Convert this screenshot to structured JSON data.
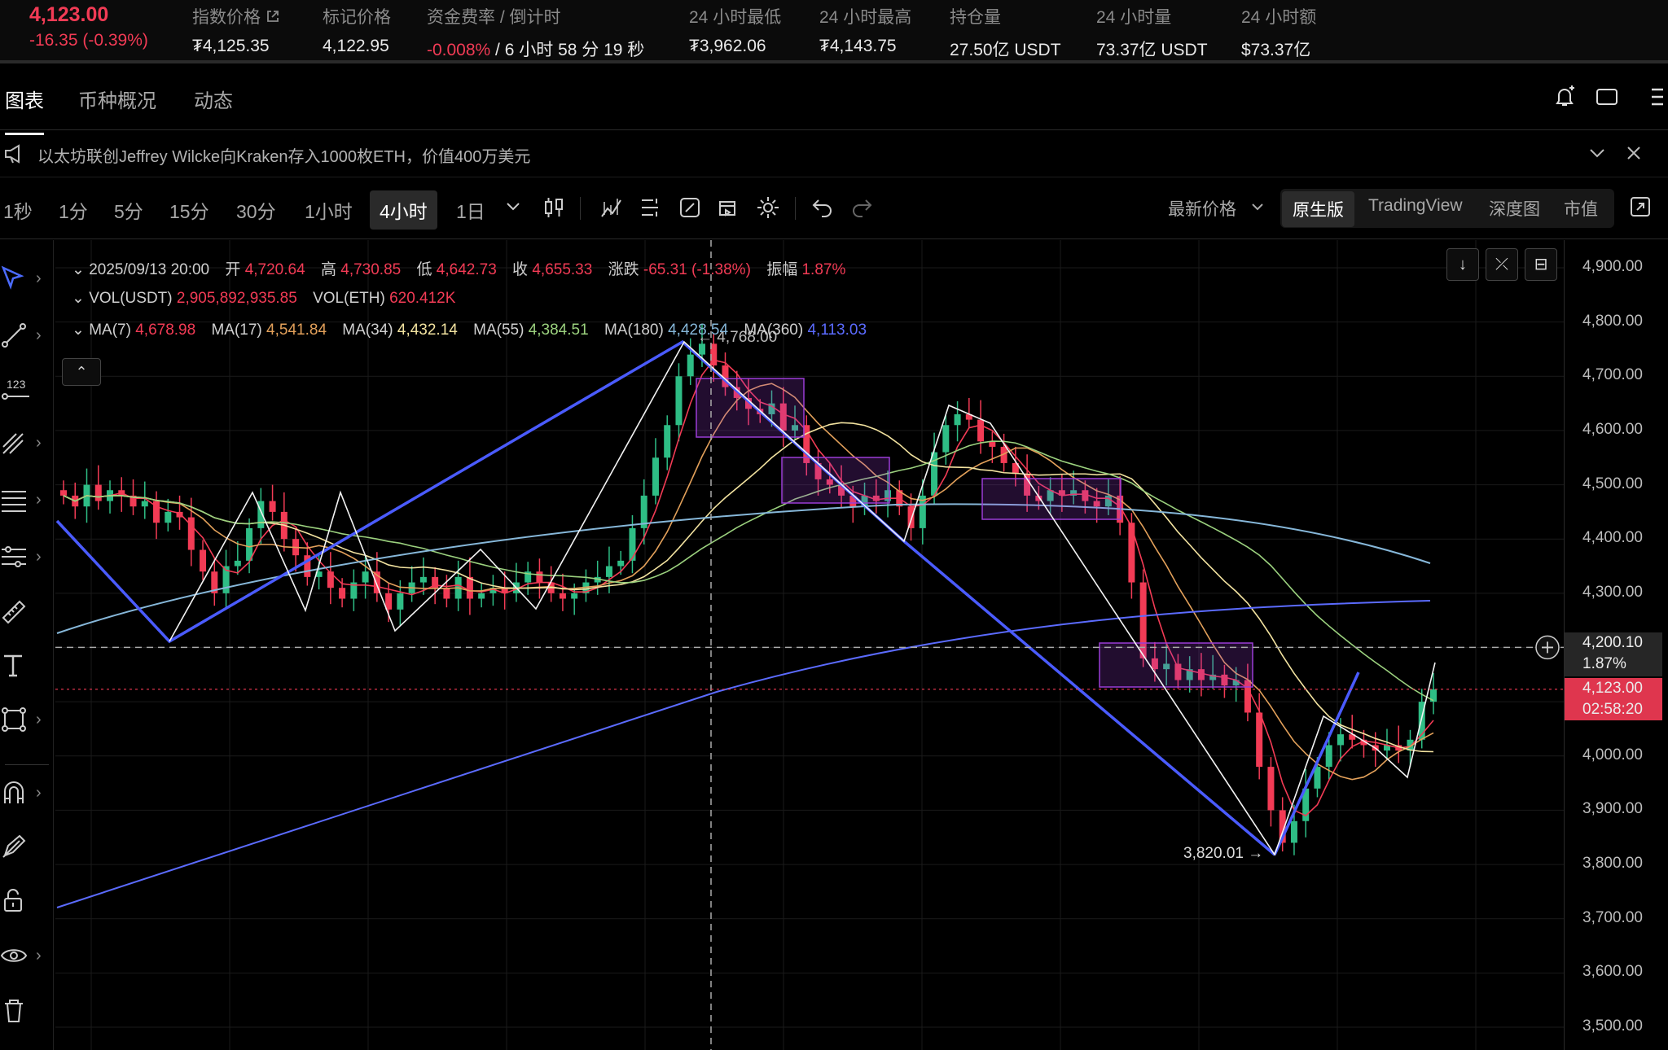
{
  "ticker": {
    "last_price": "4,123.00",
    "change": "-16.35 (-0.39%)"
  },
  "stats": [
    {
      "label": "指数价格",
      "value": "₮4,125.35",
      "has_link_icon": true
    },
    {
      "label": "标记价格",
      "value": "4,122.95"
    },
    {
      "label": "资金费率 / 倒计时",
      "value_neg": "-0.008%",
      "value": " / 6 小时 58 分 19 秒"
    },
    {
      "label": "24 小时最低",
      "value": "₮3,962.06"
    },
    {
      "label": "24 小时最高",
      "value": "₮4,143.75"
    },
    {
      "label": "持仓量",
      "value": "27.50亿 USDT"
    },
    {
      "label": "24 小时量",
      "value": "73.37亿 USDT"
    },
    {
      "label": "24 小时额",
      "value": "$73.37亿"
    }
  ],
  "tabs": [
    "图表",
    "币种概况",
    "动态"
  ],
  "news": "以太坊联创Jeffrey Wilcke向Kraken存入1000枚ETH，价值400万美元",
  "timeframes": [
    "1秒",
    "1分",
    "5分",
    "15分",
    "30分",
    "1小时",
    "4小时",
    "1日"
  ],
  "active_timeframe": "4小时",
  "price_source": "最新价格",
  "render_modes": [
    "原生版",
    "TradingView",
    "深度图",
    "市值"
  ],
  "active_render_mode": "原生版",
  "legend": {
    "date": "2025/09/13 20:00",
    "open_label": "开",
    "open": "4,720.64",
    "high_label": "高",
    "high": "4,730.85",
    "low_label": "低",
    "low": "4,642.73",
    "close_label": "收",
    "close": "4,655.33",
    "change_label": "涨跌",
    "change": "-65.31 (-1.38%)",
    "amp_label": "振幅",
    "amp": "1.87%",
    "vol_usdt_label": "VOL(USDT)",
    "vol_usdt": "2,905,892,935.85",
    "vol_eth_label": "VOL(ETH)",
    "vol_eth": "620.412K",
    "ma7_label": "MA(7)",
    "ma7": "4,678.98",
    "ma17_label": "MA(17)",
    "ma17": "4,541.84",
    "ma34_label": "MA(34)",
    "ma34": "4,432.14",
    "ma55_label": "MA(55)",
    "ma55": "4,384.51",
    "ma180_label": "MA(180)",
    "ma180": "4,428.54",
    "ma360_label": "MA(360)",
    "ma360": "4,113.03"
  },
  "annotations": {
    "peak": "4,768.00",
    "trough": "3,820.01"
  },
  "yaxis": {
    "ticks": [
      "4,900.00",
      "4,800.00",
      "4,700.00",
      "4,600.00",
      "4,500.00",
      "4,400.00",
      "4,300.00",
      "4,000.00",
      "3,900.00",
      "3,800.00",
      "3,700.00",
      "3,600.00",
      "3,500.00"
    ],
    "crosshair_price": "4,200.10",
    "crosshair_pct": "1.87%",
    "last_price": "4,123.00",
    "countdown": "02:58:20"
  },
  "chart_data": {
    "type": "line",
    "xlabel": "",
    "ylabel": "",
    "ylim": [
      3480,
      4930
    ],
    "series": [
      {
        "name": "MA(7)",
        "color": "#f23b55"
      },
      {
        "name": "MA(17)",
        "color": "#e2a05a"
      },
      {
        "name": "MA(34)",
        "color": "#f3e3a0"
      },
      {
        "name": "MA(55)",
        "color": "#9bd17e"
      },
      {
        "name": "MA(180)",
        "color": "#86b7d9"
      },
      {
        "name": "MA(360)",
        "color": "#5b6bff"
      }
    ],
    "candles_close": [
      4480,
      4460,
      4500,
      4470,
      4490,
      4480,
      4460,
      4470,
      4430,
      4450,
      4440,
      4380,
      4340,
      4300,
      4350,
      4360,
      4420,
      4470,
      4450,
      4400,
      4370,
      4330,
      4340,
      4310,
      4290,
      4320,
      4340,
      4300,
      4270,
      4300,
      4320,
      4330,
      4310,
      4290,
      4330,
      4290,
      4300,
      4310,
      4300,
      4320,
      4340,
      4320,
      4300,
      4290,
      4300,
      4320,
      4330,
      4350,
      4360,
      4420,
      4480,
      4550,
      4610,
      4700,
      4740,
      4760,
      4720,
      4680,
      4660,
      4640,
      4630,
      4650,
      4600,
      4610,
      4540,
      4510,
      4500,
      4480,
      4460,
      4480,
      4470,
      4490,
      4460,
      4420,
      4480,
      4560,
      4610,
      4630,
      4620,
      4580,
      4570,
      4540,
      4520,
      4480,
      4470,
      4490,
      4480,
      4490,
      4470,
      4460,
      4480,
      4430,
      4320,
      4180,
      4160,
      4170,
      4140,
      4160,
      4140,
      4150,
      4130,
      4140,
      4080,
      3980,
      3900,
      3840,
      3880,
      3940,
      3980,
      4020,
      4040,
      4030,
      4020,
      4010,
      4020,
      4010,
      4030,
      4100,
      4123
    ],
    "trend_lines": "blue and white zigzag annotations",
    "crosshair_value": 4200.1,
    "last_price_value": 4123.0
  },
  "colors": {
    "up": "#2ebd85",
    "down": "#f23b55",
    "ma7": "#f23b55",
    "ma17": "#e2a05a",
    "ma34": "#f3e3a0",
    "ma55": "#9bd17e",
    "ma180": "#86b7d9",
    "ma360": "#5b6bff",
    "trend": "#4a5bff",
    "box": "#9b3dd6"
  },
  "icons": [
    "external-link-icon",
    "alarm-icon",
    "fullscreen-icon",
    "more-icon",
    "speaker-icon",
    "chevron-down-icon",
    "close-icon",
    "candle-type-icon",
    "indicator-icon",
    "template-icon",
    "draw-icon",
    "replay-icon",
    "settings-icon",
    "undo-icon",
    "redo-icon",
    "expand-icon"
  ]
}
